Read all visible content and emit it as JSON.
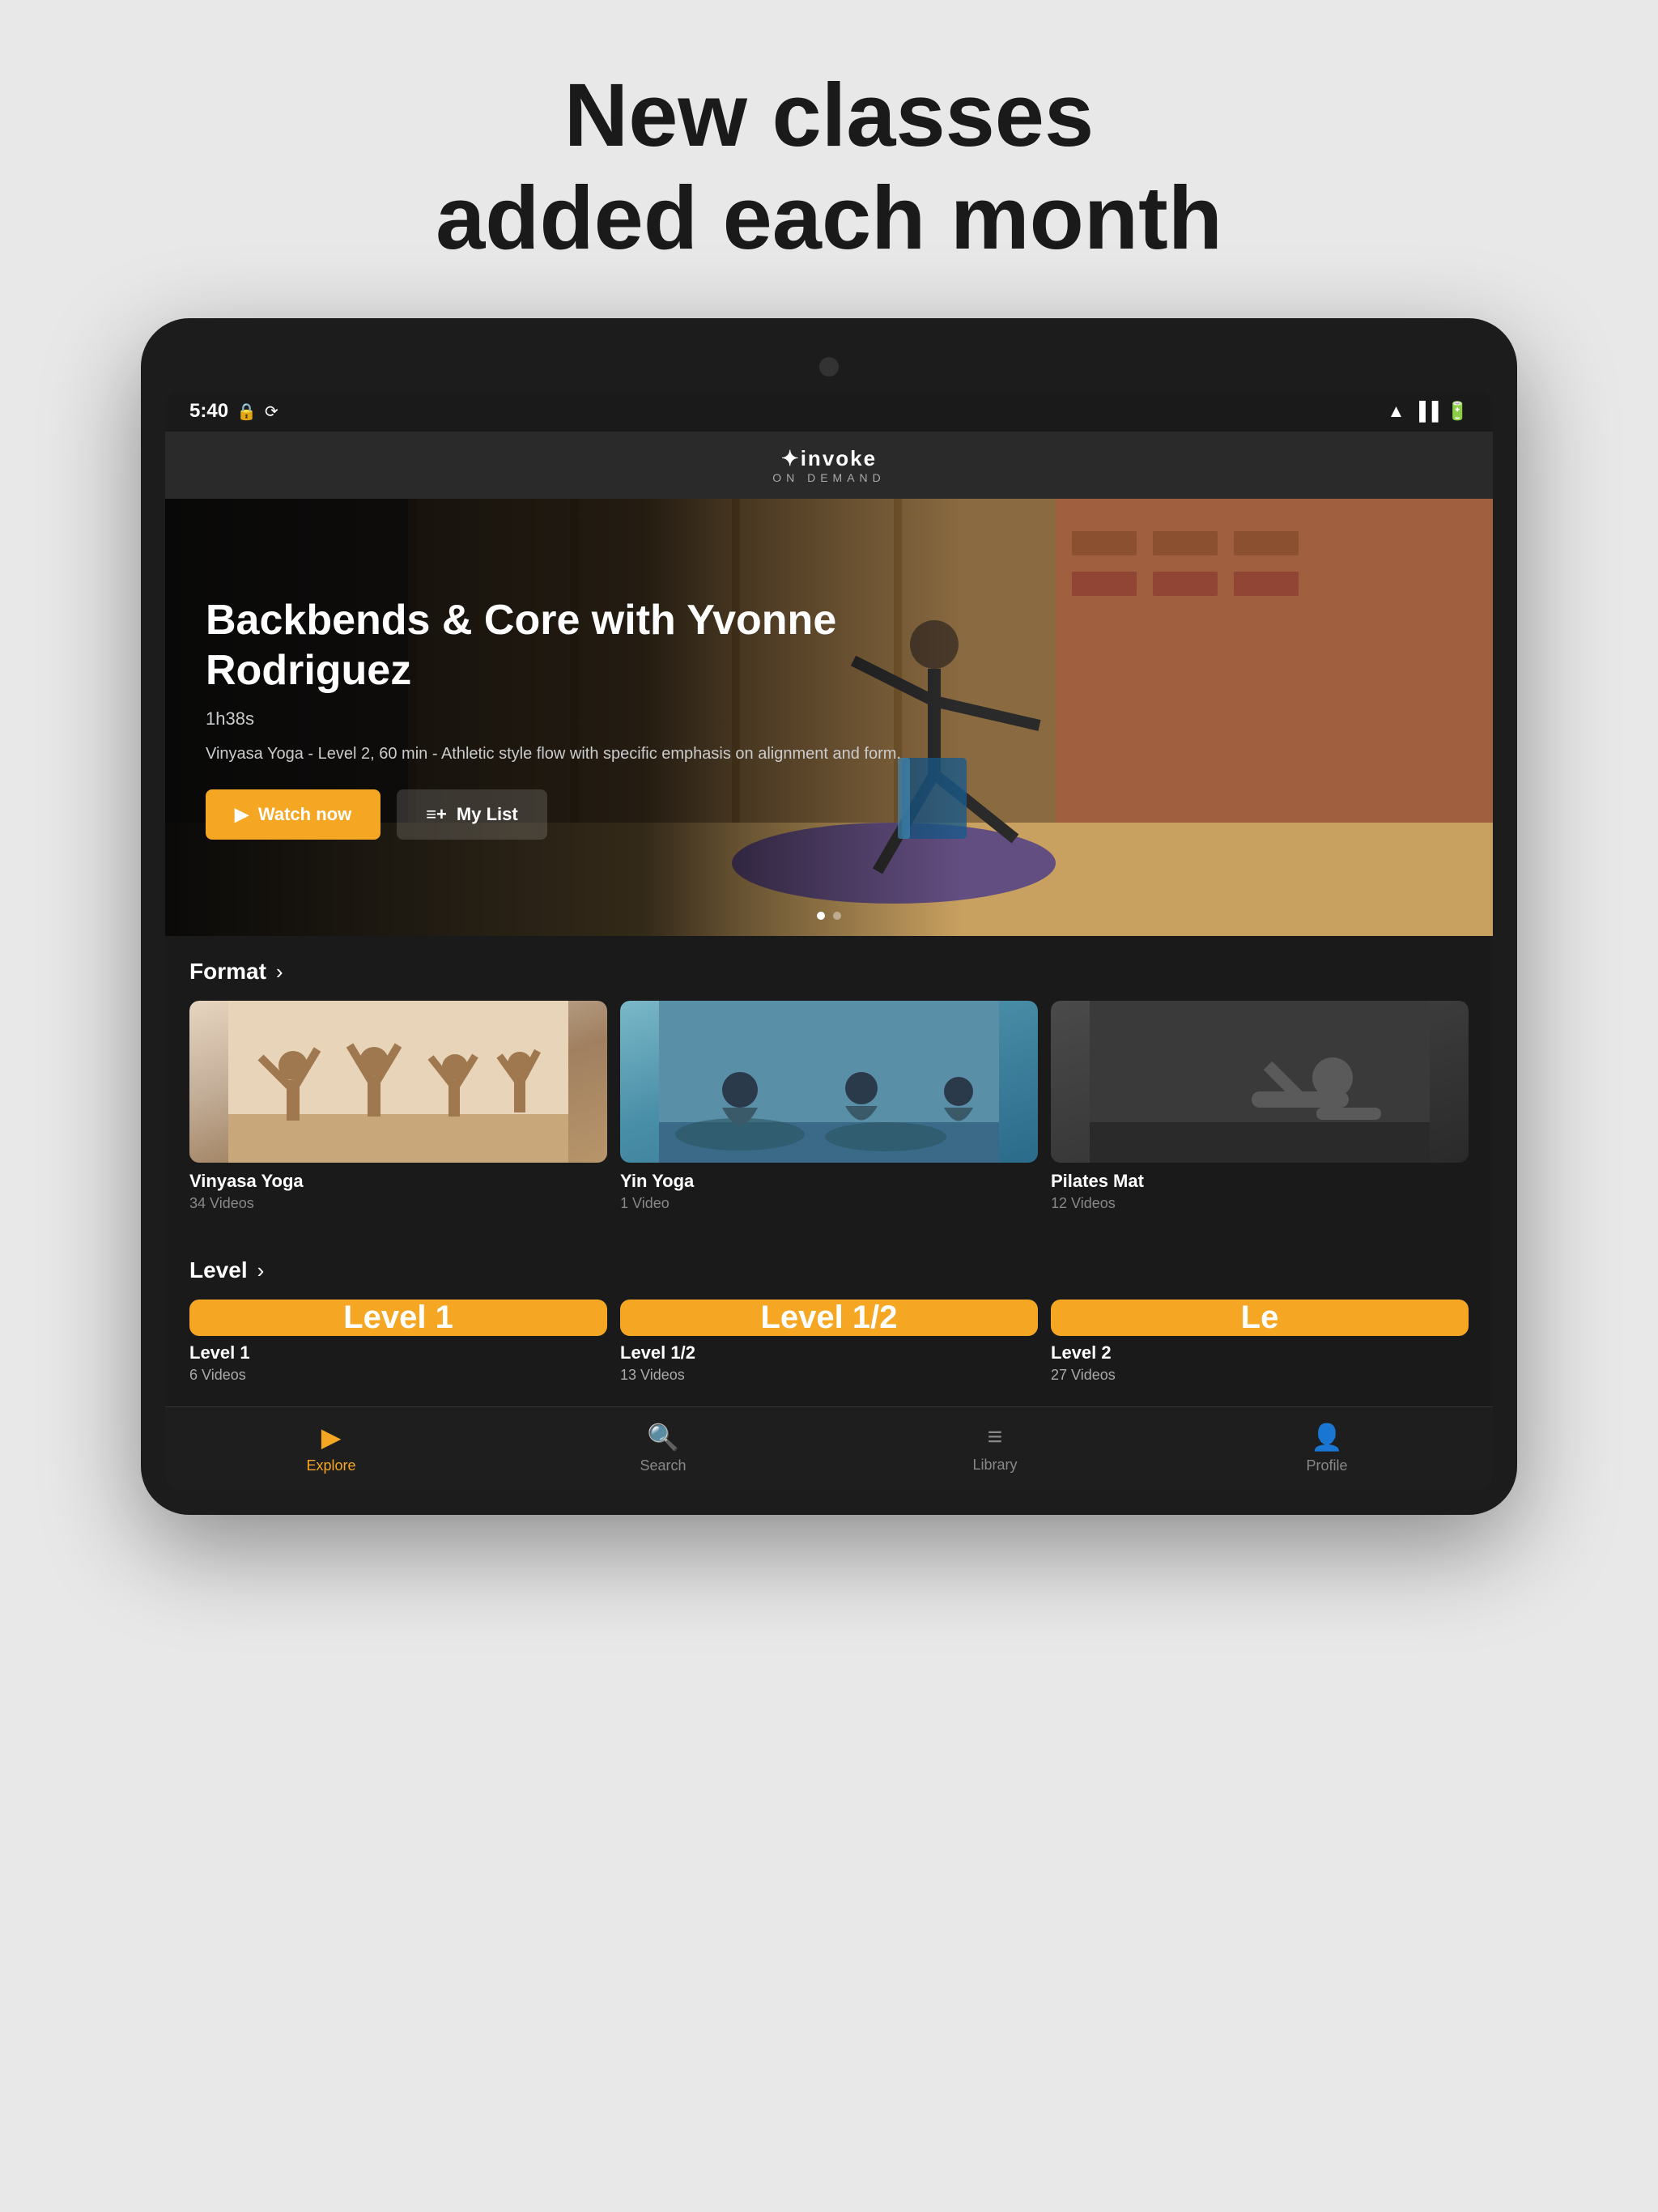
{
  "page": {
    "title_line1": "New classes",
    "title_line2": "added each month"
  },
  "app": {
    "logo": "✦invoke",
    "logo_sub": "ON DEMAND"
  },
  "status_bar": {
    "time": "5:40",
    "icons": "▲◆🔋"
  },
  "hero": {
    "title": "Backbends & Core with Yvonne Rodriguez",
    "duration": "1h38s",
    "description": "Vinyasa Yoga - Level 2, 60 min - Athletic style flow with specific emphasis on alignment and form.",
    "watch_label": "Watch now",
    "mylist_label": "My List"
  },
  "format_section": {
    "label": "Format",
    "arrow": "›",
    "cards": [
      {
        "name": "Vinyasa Yoga",
        "count": "34 Videos",
        "type": "vinyasa"
      },
      {
        "name": "Yin Yoga",
        "count": "1 Video",
        "type": "yin"
      },
      {
        "name": "Pilates Mat",
        "count": "12 Videos",
        "type": "pilates"
      }
    ]
  },
  "level_section": {
    "label": "Level",
    "arrow": "›",
    "cards": [
      {
        "name": "Level 1",
        "count": "6 Videos",
        "label": "Level 1"
      },
      {
        "name": "Level 1/2",
        "count": "13 Videos",
        "label": "Level 1/2"
      },
      {
        "name": "Level 2",
        "count": "27 Videos",
        "label": "Le"
      }
    ]
  },
  "nav": {
    "items": [
      {
        "id": "explore",
        "label": "Explore",
        "active": true
      },
      {
        "id": "search",
        "label": "Search",
        "active": false
      },
      {
        "id": "library",
        "label": "Library",
        "active": false
      },
      {
        "id": "profile",
        "label": "Profile",
        "active": false
      }
    ]
  },
  "colors": {
    "accent": "#f5a623",
    "bg_dark": "#1a1a1a",
    "bg_medium": "#2a2a2a"
  }
}
